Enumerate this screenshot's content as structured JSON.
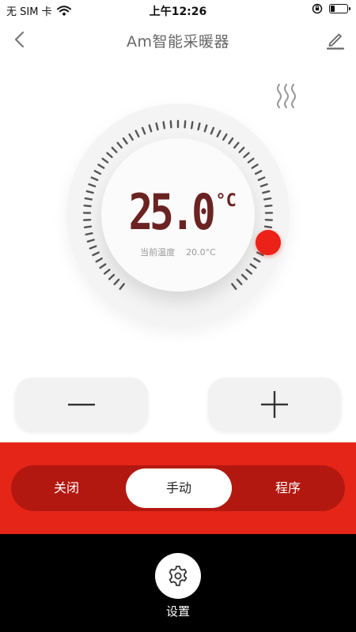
{
  "status_bar": {
    "carrier": "无 SIM 卡",
    "time": "上午12:26"
  },
  "nav": {
    "title": "Am智能采暖器",
    "back_icon": "chevron-left-icon",
    "edit_icon": "pencil-icon"
  },
  "heater": {
    "set_temperature": "25.0",
    "unit": "°C",
    "current_label": "当前温度",
    "current_value": "20.0°C",
    "heat_icon": "heat-waves-icon"
  },
  "controls": {
    "minus_icon": "minus-icon",
    "plus_icon": "plus-icon"
  },
  "modes": {
    "items": [
      "关闭",
      "手动",
      "程序"
    ],
    "selected": "手动"
  },
  "settings": {
    "label": "设置",
    "icon": "gear-icon"
  },
  "colors": {
    "accent": "#e52518",
    "track": "#b21810",
    "temp_text": "#6b2322",
    "knob": "#ec2117"
  }
}
